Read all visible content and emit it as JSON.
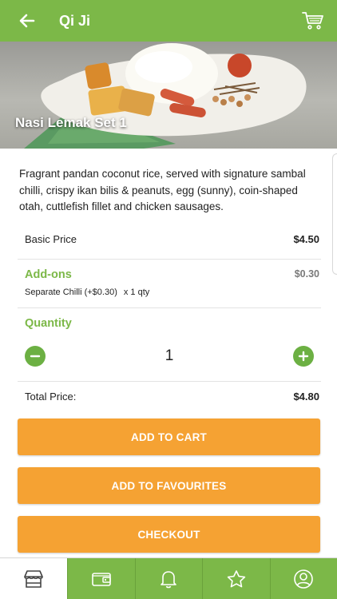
{
  "header": {
    "title": "Qi Ji",
    "back_icon": "back-arrow-icon",
    "cart_icon": "cart-icon"
  },
  "item": {
    "name": "Nasi Lemak Set 1",
    "description": "Fragrant pandan coconut rice, served with signature sambal chilli, crispy ikan bilis & peanuts, egg (sunny), coin-shaped otah, cuttlefish fillet and chicken sausages."
  },
  "pricing": {
    "basic_label": "Basic Price",
    "basic_value": "$4.50",
    "addons_label": "Add-ons",
    "addons_value": "$0.30",
    "addon_item": "Separate Chilli (+$0.30)",
    "addon_qty": "x 1 qty",
    "quantity_label": "Quantity",
    "quantity": "1",
    "total_label": "Total Price:",
    "total_value": "$4.80"
  },
  "actions": {
    "add_to_cart": "ADD TO CART",
    "add_to_favourites": "ADD TO FAVOURITES",
    "checkout": "CHECKOUT"
  },
  "bottom_nav": [
    "home-store-icon",
    "wallet-icon",
    "bell-icon",
    "star-icon",
    "profile-icon"
  ],
  "colors": {
    "green": "#7cb848",
    "orange": "#f5a233"
  }
}
